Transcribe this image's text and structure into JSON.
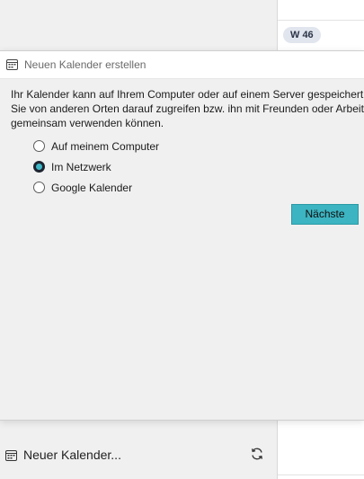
{
  "background": {
    "week_label": "W 46"
  },
  "dialog": {
    "title": "Neuen Kalender erstellen",
    "description_lines": [
      "Ihr Kalender kann auf Ihrem Computer oder auf einem Server gespeichert w",
      "Sie von anderen Orten darauf zugreifen bzw. ihn mit Freunden oder Arbeits",
      "gemeinsam verwenden können."
    ],
    "options": [
      {
        "label": "Auf meinem Computer",
        "checked": false
      },
      {
        "label": "Im Netzwerk",
        "checked": true
      },
      {
        "label": "Google Kalender",
        "checked": false
      }
    ],
    "next_label": "Nächste"
  },
  "bottom_bar": {
    "new_calendar_label": "Neuer Kalender...",
    "sync_icon": "sync-icon"
  },
  "colors": {
    "accent": "#3cb4c1",
    "radio_selected_fill": "#3fb7c7"
  }
}
